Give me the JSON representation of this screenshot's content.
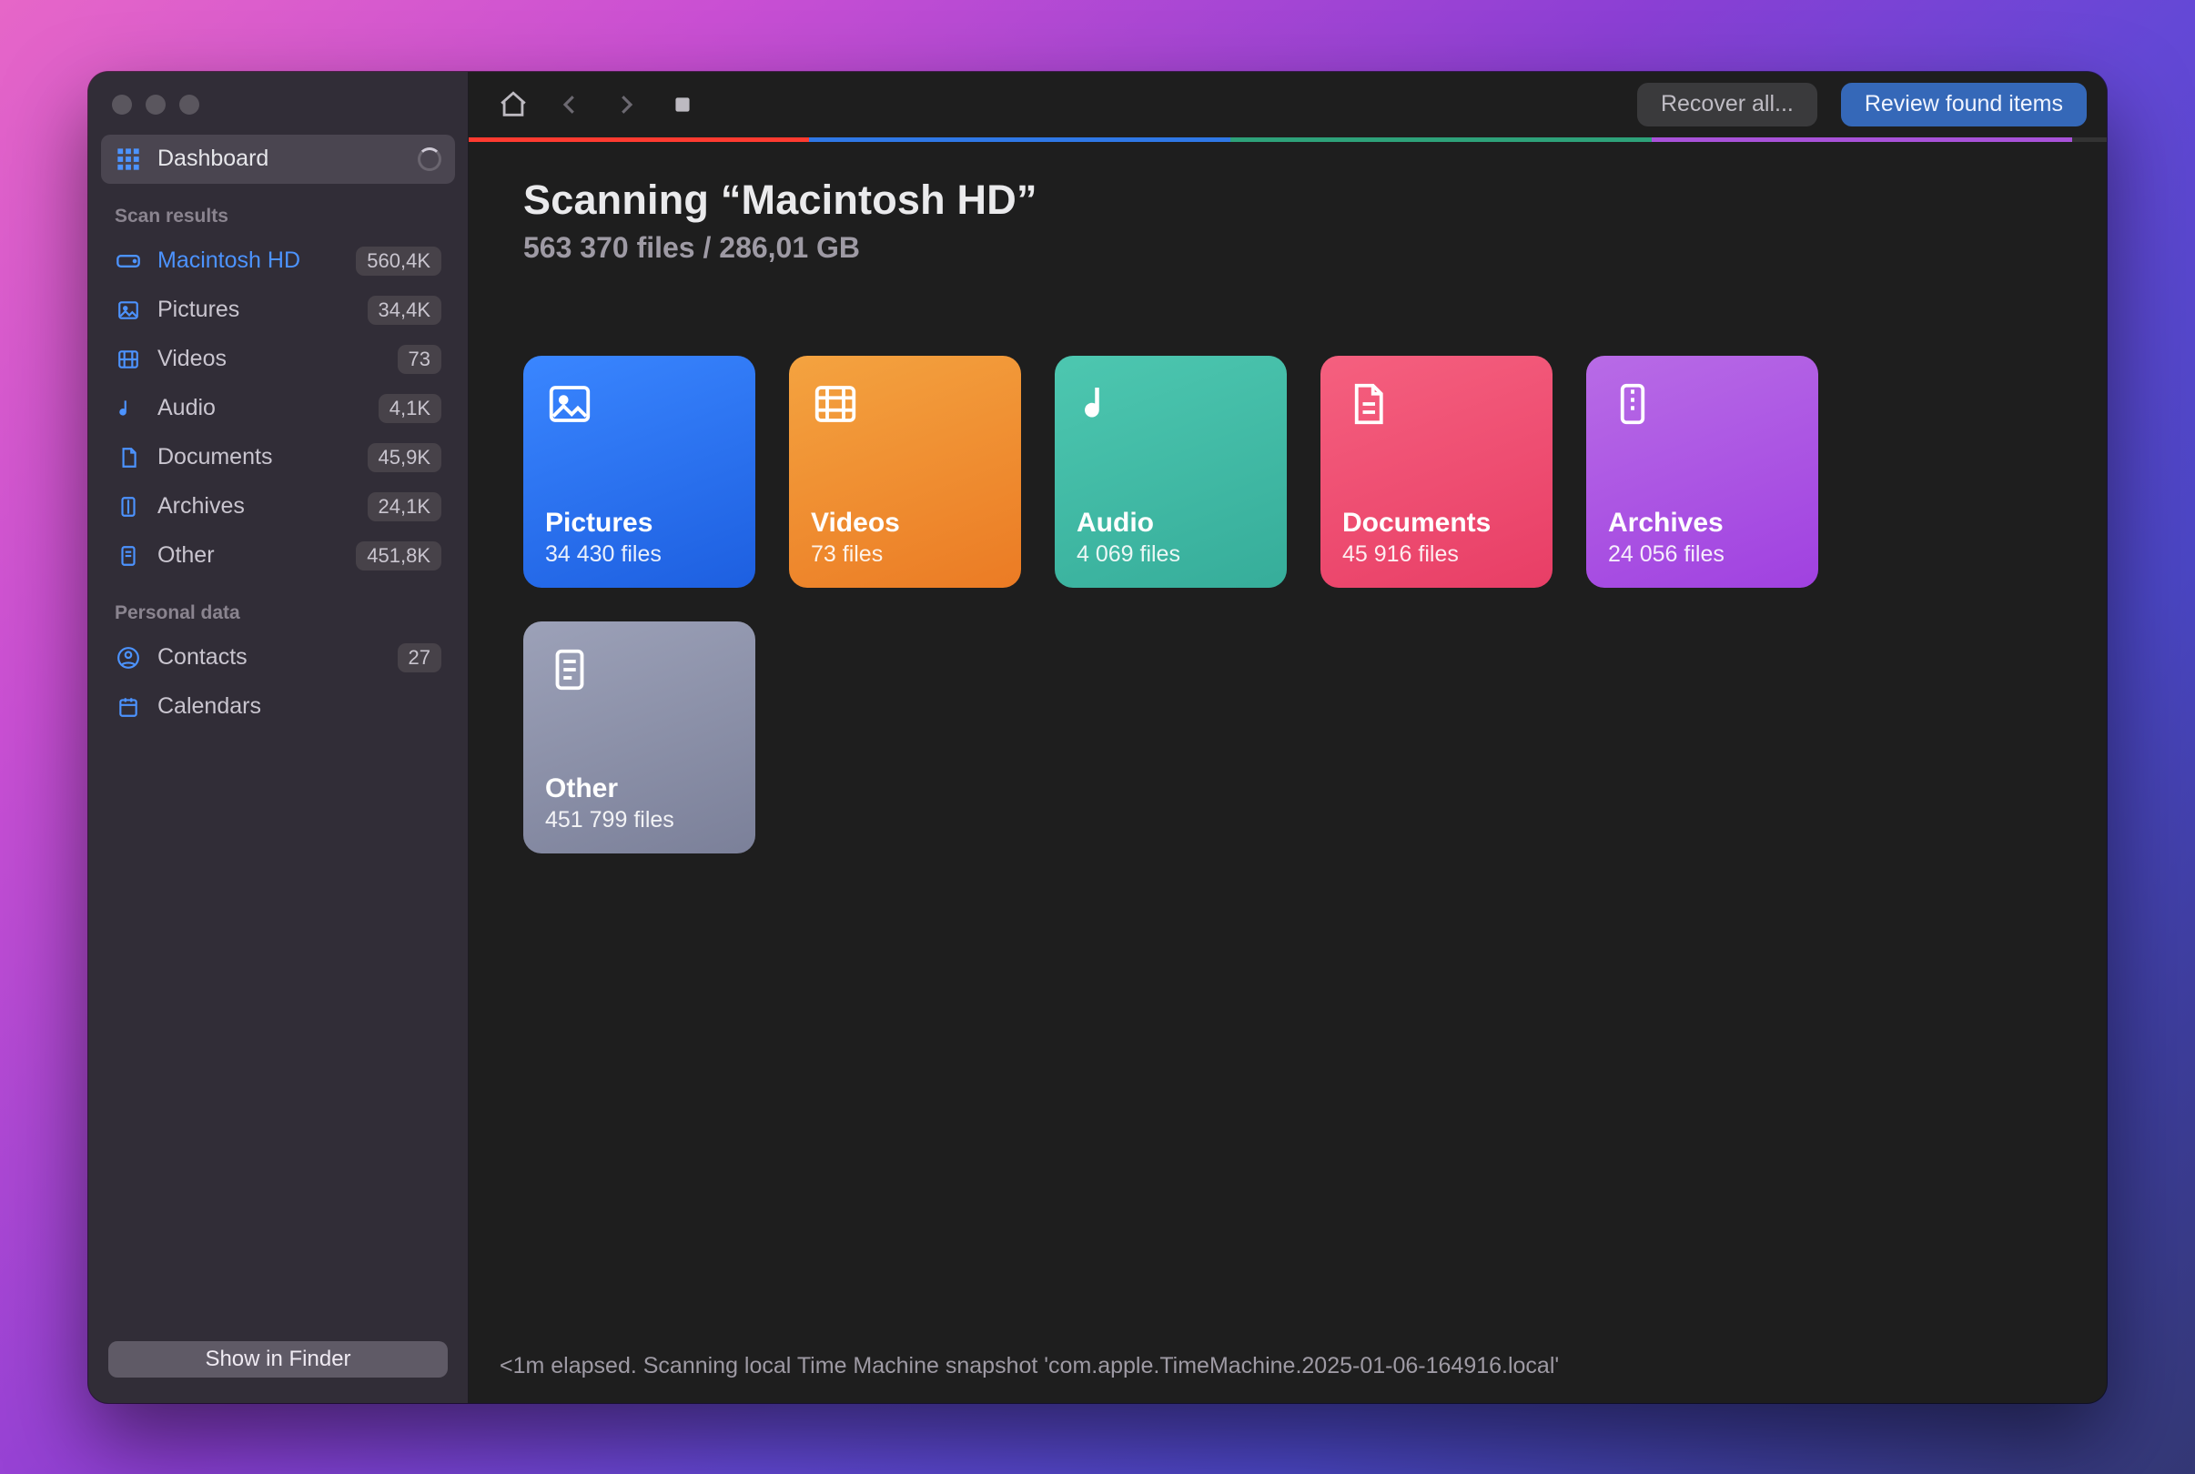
{
  "sidebar": {
    "dashboard_label": "Dashboard",
    "section_scan": "Scan results",
    "section_personal": "Personal data",
    "items": [
      {
        "label": "Macintosh HD",
        "badge": "560,4K"
      },
      {
        "label": "Pictures",
        "badge": "34,4K"
      },
      {
        "label": "Videos",
        "badge": "73"
      },
      {
        "label": "Audio",
        "badge": "4,1K"
      },
      {
        "label": "Documents",
        "badge": "45,9K"
      },
      {
        "label": "Archives",
        "badge": "24,1K"
      },
      {
        "label": "Other",
        "badge": "451,8K"
      }
    ],
    "personal": [
      {
        "label": "Contacts",
        "badge": "27"
      },
      {
        "label": "Calendars",
        "badge": ""
      }
    ],
    "show_in_finder": "Show in Finder"
  },
  "toolbar": {
    "recover_all": "Recover all...",
    "review": "Review found items"
  },
  "header": {
    "title": "Scanning “Macintosh HD”",
    "subtitle": "563 370 files / 286,01 GB"
  },
  "progress": [
    {
      "color": "#ff3b30",
      "pct": 20.8
    },
    {
      "color": "#2f78e6",
      "pct": 25.7
    },
    {
      "color": "#2ea27a",
      "pct": 25.7
    },
    {
      "color": "#a852d9",
      "pct": 25.7
    },
    {
      "color": "#333333",
      "pct": 2.1
    }
  ],
  "cards": [
    {
      "name": "Pictures",
      "count": "34 430 files",
      "gradient": [
        "#3a86ff",
        "#1d5fe0"
      ],
      "icon": "image"
    },
    {
      "name": "Videos",
      "count": "73 files",
      "gradient": [
        "#f4a340",
        "#eb7b24"
      ],
      "icon": "film"
    },
    {
      "name": "Audio",
      "count": "4 069 files",
      "gradient": [
        "#4dc7b0",
        "#36ad9a"
      ],
      "icon": "note"
    },
    {
      "name": "Documents",
      "count": "45 916 files",
      "gradient": [
        "#f5607f",
        "#e83e66"
      ],
      "icon": "doc"
    },
    {
      "name": "Archives",
      "count": "24 056 files",
      "gradient": [
        "#b86be6",
        "#a041e0"
      ],
      "icon": "zip"
    },
    {
      "name": "Other",
      "count": "451 799 files",
      "gradient": [
        "#9ca1b8",
        "#7b8099"
      ],
      "icon": "sheet"
    }
  ],
  "status": "<1m elapsed. Scanning local Time Machine snapshot 'com.apple.TimeMachine.2025-01-06-164916.local'"
}
